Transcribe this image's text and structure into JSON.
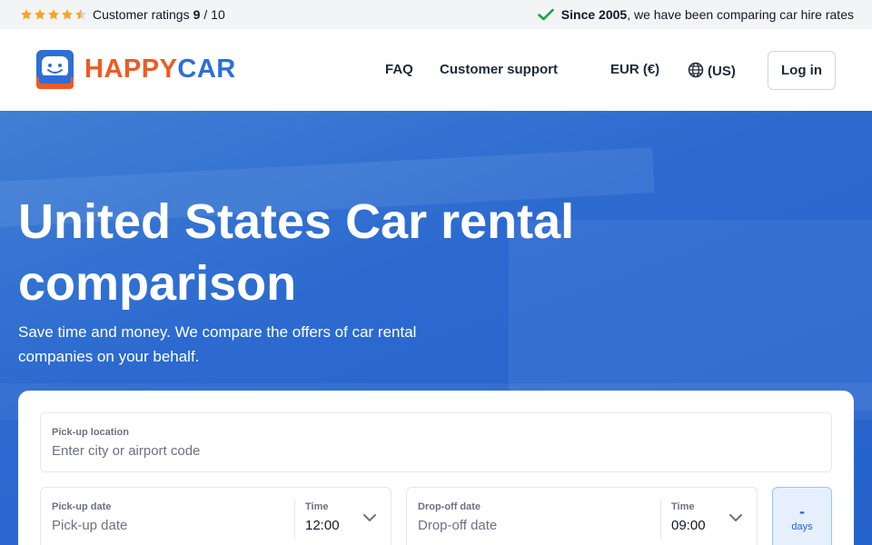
{
  "topbar": {
    "rating_label": "Customer ratings",
    "rating_value": "9",
    "rating_max": "/ 10",
    "stars": 4.5,
    "since_bold": "Since 2005",
    "since_rest": ", we have been comparing car hire rates"
  },
  "header": {
    "logo_happy": "HAPPY",
    "logo_car": "CAR",
    "nav": {
      "faq": "FAQ",
      "support": "Customer support",
      "currency": "EUR (€)",
      "region": "(US)"
    },
    "login": "Log in"
  },
  "hero": {
    "title": "United States Car rental comparison",
    "subtitle": "Save time and money. We compare the offers of car rental companies on your behalf."
  },
  "search": {
    "pickup_location_label": "Pick-up location",
    "pickup_location_placeholder": "Enter city or airport code",
    "pickup_date_label": "Pick-up date",
    "pickup_date_placeholder": "Pick-up date",
    "pickup_time_label": "Time",
    "pickup_time_value": "12:00",
    "dropoff_date_label": "Drop-off date",
    "dropoff_date_placeholder": "Drop-off date",
    "dropoff_time_label": "Time",
    "dropoff_time_value": "09:00",
    "days_value": "-",
    "days_label": "days"
  },
  "colors": {
    "brand_orange": "#ef5a24",
    "brand_blue": "#2d6fd6",
    "hero_blue": "#2c6ad0",
    "star": "#f5a623",
    "check": "#16a34a"
  },
  "icons": [
    "star-icon",
    "check-icon",
    "logo-car-icon",
    "globe-icon",
    "chevron-down-icon"
  ]
}
